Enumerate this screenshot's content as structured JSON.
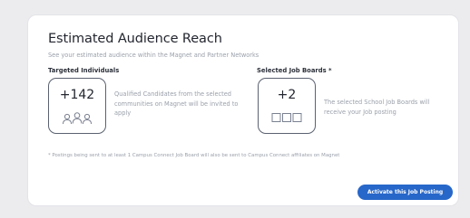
{
  "reach": {
    "title": "Estimated Audience Reach",
    "subtitle": "See your estimated audience within the Magnet and Partner Networks"
  },
  "targeted": {
    "label": "Targeted Individuals",
    "count": "+142",
    "icon": "users-icon",
    "description": "Qualified Candidates from the selected communities on Magnet will be invited to apply"
  },
  "boards": {
    "label": "Selected Job Boards *",
    "count": "+2",
    "icon": "job-boards-icon",
    "description": "The selected School Job Boards will receive your Job posting"
  },
  "footnote": "* Postings being sent to at least 1 Campus Connect Job Board will also be sent to Campus Connect affiliates on Magnet",
  "actions": {
    "activate_label": "Activate this Job Posting"
  },
  "colors": {
    "accent": "#2767c9",
    "background": "#ececef",
    "card": "#ffffff"
  }
}
